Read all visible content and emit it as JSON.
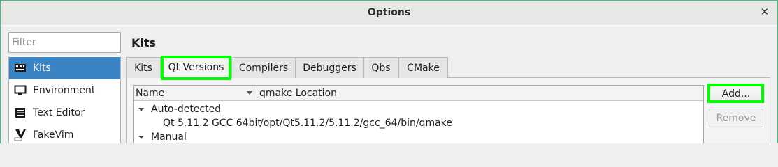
{
  "window": {
    "title": "Options",
    "close_glyph": "✕"
  },
  "filter": {
    "placeholder": "Filter",
    "value": ""
  },
  "sidebar": {
    "items": [
      {
        "label": "Kits",
        "icon": "kits-icon",
        "selected": true
      },
      {
        "label": "Environment",
        "icon": "monitor-icon",
        "selected": false
      },
      {
        "label": "Text Editor",
        "icon": "text-editor-icon",
        "selected": false
      },
      {
        "label": "FakeVim",
        "icon": "fakevim-icon",
        "selected": false
      }
    ]
  },
  "page": {
    "heading": "Kits"
  },
  "tabs": [
    {
      "label": "Kits",
      "active": false
    },
    {
      "label": "Qt Versions",
      "active": true
    },
    {
      "label": "Compilers",
      "active": false
    },
    {
      "label": "Debuggers",
      "active": false
    },
    {
      "label": "Qbs",
      "active": false
    },
    {
      "label": "CMake",
      "active": false
    }
  ],
  "tree": {
    "columns": [
      "Name",
      "qmake Location"
    ],
    "groups": [
      {
        "label": "Auto-detected",
        "rows": [
          {
            "name": "Qt 5.11.2 GCC 64bit",
            "location": "/opt/Qt5.11.2/5.11.2/gcc_64/bin/qmake"
          }
        ]
      },
      {
        "label": "Manual",
        "rows": []
      }
    ]
  },
  "buttons": {
    "add": "Add...",
    "remove": "Remove"
  },
  "colors": {
    "selection": "#3a84c4",
    "highlight": "#00ff00",
    "window_border": "#3fbf7f"
  }
}
